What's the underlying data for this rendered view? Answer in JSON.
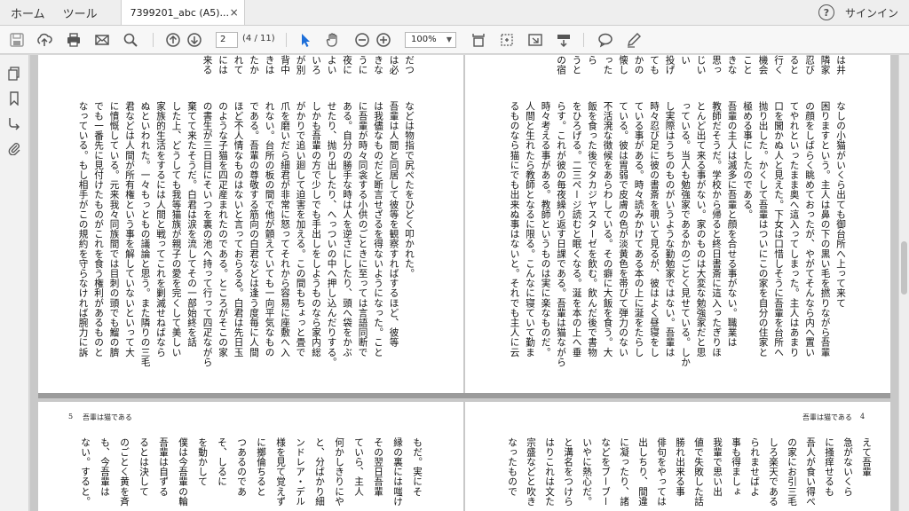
{
  "menu": {
    "home": "ホーム",
    "tools": "ツール"
  },
  "tab": {
    "title": "7399201_abc (A5)...",
    "close": "×"
  },
  "header": {
    "help": "?",
    "signin": "サインイン"
  },
  "toolbar": {
    "page_current": "2",
    "page_count": "(4 / 11)",
    "zoom": "100%",
    "icons": [
      "save-icon",
      "upload-icon",
      "print-icon",
      "mail-icon",
      "search-icon",
      "prev-page-icon",
      "next-page-icon",
      "select-arrow-icon",
      "hand-icon",
      "zoom-out-icon",
      "zoom-in-icon",
      "fit-page-icon",
      "crop-icon",
      "full-screen-icon",
      "read-mode-icon",
      "comment-icon",
      "pen-icon"
    ]
  },
  "leftpane": {
    "icons": [
      "pages-icon",
      "bookmark-icon",
      "attachments-icon",
      "paperclip-icon"
    ]
  },
  "pages": {
    "p5": {
      "number": "5",
      "running_head": "吾輩は猫である",
      "columns": [
        "などは物指で尻ぺたをひどく叩かれた。",
        "吾輩は人間と同居して彼等を観察すればするほど、彼等",
        "は我儘なものだと断言せざるを得ないようになった。こと",
        "に吾輩が時々同衾する小供のごときに至っては言語同断で",
        "ある。自分の勝手な時は人を逆さにしたり、頭へ袋をかぶ",
        "せたり、抛り出したり、へっついの中へ押し込んだりする。",
        "しかも吾輩の方で少しでも手出しをしようものなら家内総",
        "がかりで追い廻して迫害を加える。この間もちょっと畳で",
        "爪を磨いだら細君が非常に怒ってそれから容易に座敷へ入",
        "れない。台所の板の間で他が顫えていても一向平気なもの",
        "である。吾輩の尊敬する筋向の白君などは逢う度毎に人間",
        "ほど不人情なものはないと言っておらるる。白君は先日玉",
        "のような子猫を四疋産まれたのである。ところがそこの家",
        "の書生が三日目にそいつを裏の池へ持って行って四疋ながら",
        "棄てて来たそうだ。白君は涙を流してその一部始終を話",
        "した上、どうしても我等猫族が親子の愛を完くして美しい",
        "家族的生活をするには人間と戦ってこれを剿滅せねばなら",
        "ぬといわれた。一々もっともの議論と思う。また隣りの三毛",
        "君などは人間が所有権という事を解していないといって大",
        "に憤慨している。元来我々同族間では目刺の頭でも鰡の臍",
        "でも一番先に見付けたものがこれを食う権利があるものと",
        "なっている。もし相手がこの規約を守らなければ腕力に訴"
      ],
      "top_fragments": [
        "だつ",
        "は必",
        "きな",
        "うに",
        "夜に",
        "よい",
        "いろ",
        "が別",
        "背中",
        "きは",
        "たか",
        "れて",
        "には",
        "来る"
      ]
    },
    "p4": {
      "number": "4",
      "running_head": "吾輩は猫である",
      "columns": [
        "なしの小猫がいくら出ても御台所へ上って来て",
        "困りますという。主人は鼻の下の黒い毛を撚りながら吾輩",
        "の顔をしばらく眺めておったが、やがてそんなら内へ置い",
        "てやれといったまま奥へ這入ってしまった。主人はあまり",
        "口を聞かぬ人と見えた。下女は口惜しそうに吾輩を台所へ",
        "抛り出した。かくして吾輩はついにこの家を自分の住家と",
        "極める事にしたのである。",
        "吾輩の主人は滅多に吾輩と顔を合せる事がない。職業は",
        "教師だそうだ。学校から帰ると終日書斎に這入ったぎりほ",
        "とんど出て来る事がない。家のものは大変な勉強家だと思",
        "っている。当人も勉強家であるかのごとく見せている。しか",
        "し実際はうちのものがいうような勤勉家ではない。吾輩は",
        "時々忍び足に彼の書斎を覗いて見るが、彼はよく昼寝をし",
        "ている事がある。時々読みかけてある本の上に涎をたらし",
        "ている。彼は胃弱で皮膚の色が淡黄色を帯びて弾力のない",
        "不活溌な徴候をあらわしている。その癖に大飯を食う。大",
        "飯を食った後でタカジヤスターゼを飲む。飲んだ後で書物",
        "をひろげる。二三ページ読むと眠くなる。涎を本の上へ垂",
        "らす。これが彼の毎夜繰り返す日課である。吾輩は猫ながら",
        "時々考える事がある。教師というものは実に楽なものだ。",
        "人間と生れたら教師となるに限る。こんなに寝ていて勤ま",
        "るものなら猫にでも出来ぬ事はないと。それでも主人に云"
      ],
      "top_fragments": [
        "は井",
        "隣家",
        "忍び",
        "ると",
        "行く",
        "機会",
        "こと",
        "きな",
        "思っ",
        "じい",
        "い",
        "投げ",
        "ても",
        "かの",
        "懐し",
        "った",
        "ら",
        "うと",
        "の宿"
      ]
    },
    "p7": {
      "columns": [
        "もだ。実にそ",
        "縁の裏には嗤け",
        "その翌日吾輩",
        "ていら、主人",
        "何かしきりにや",
        "と、分ばかり細",
        "ンドレア・デル",
        "様を見て覚えず",
        "に擲倫ちると",
        "つあるのであ",
        "そ、しるに",
        "を動かして",
        "僕は今吾輩の輪",
        "吾輩は自ずる",
        "るとは決して",
        "のごとく黄を斉",
        "も、今吾輩は",
        "ない。すると。"
      ]
    },
    "p6": {
      "columns": [
        "えて吾輩",
        "急がないくら",
        "に掻痒せるも",
        "吾人が食い得ぺ",
        "の家にお引三毛",
        "しろ楽天である",
        "られませばよ",
        "事も得ましょ",
        "我輩で思い出",
        "値で失敗した話",
        "勝れ出来る事",
        "俳句をやっては",
        "出しちり、間違",
        "に凝ったり、諸",
        "などをブーブー",
        "いやに熱心だ。",
        "と溝名をつけら",
        "はりこれは文た",
        "宗盛などと吹き",
        "なったもので"
      ]
    }
  }
}
